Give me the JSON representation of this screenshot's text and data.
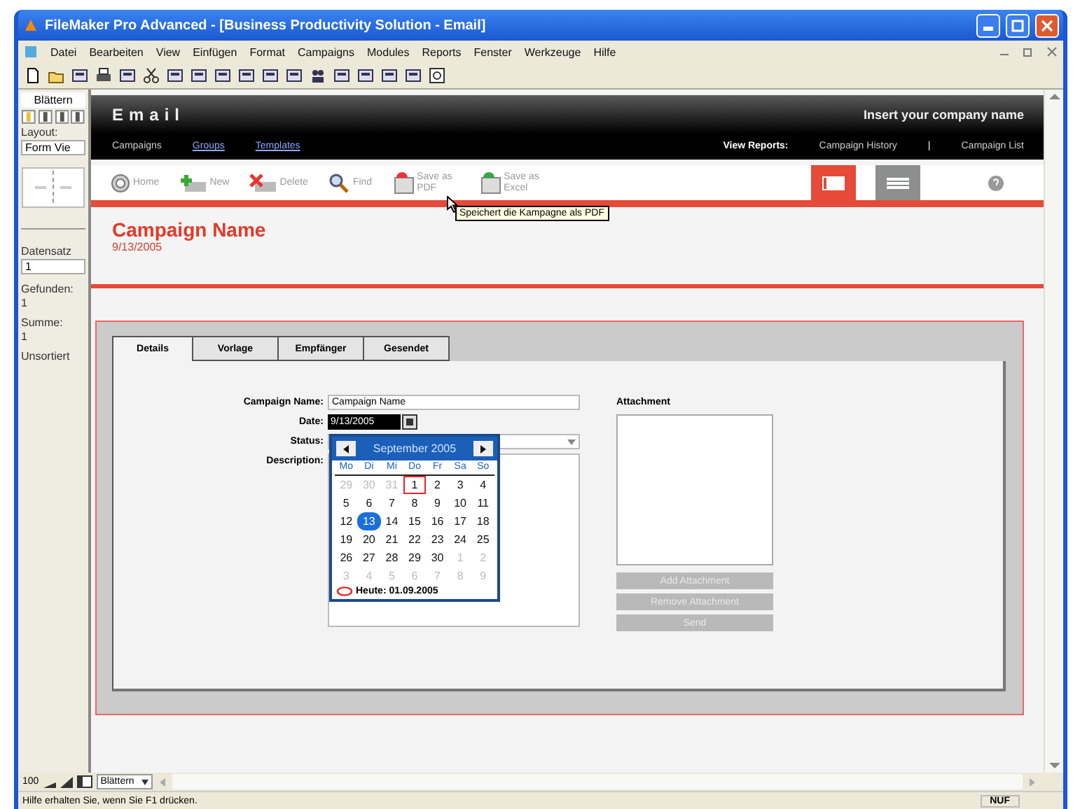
{
  "window": {
    "title": "FileMaker Pro Advanced - [Business Productivity Solution - Email]"
  },
  "menu": [
    "Datei",
    "Bearbeiten",
    "View",
    "Einfügen",
    "Format",
    "Campaigns",
    "Modules",
    "Reports",
    "Fenster",
    "Werkzeuge",
    "Hilfe"
  ],
  "sidebar": {
    "mode": "Blättern",
    "layout_label": "Layout:",
    "layout_value": "Form Vie",
    "record_label": "Datensatz",
    "record_value": "1",
    "found_label": "Gefunden:",
    "found_value": "1",
    "total_label": "Summe:",
    "total_value": "1",
    "sort_state": "Unsortiert"
  },
  "header": {
    "title": "Email",
    "company": "Insert your company name",
    "nav": [
      {
        "label": "Campaigns",
        "selected": true
      },
      {
        "label": "Groups",
        "selected": false
      },
      {
        "label": "Templates",
        "selected": false
      }
    ],
    "reports_label": "View Reports:",
    "reports": [
      "Campaign History",
      "Campaign List"
    ],
    "separator": "|"
  },
  "toolbar": [
    {
      "kind": "home",
      "label": "Home"
    },
    {
      "kind": "new",
      "label": "New"
    },
    {
      "kind": "delete",
      "label": "Delete"
    },
    {
      "kind": "find",
      "label": "Find"
    },
    {
      "kind": "pdf",
      "label": "Save as PDF"
    },
    {
      "kind": "excel",
      "label": "Save as Excel"
    }
  ],
  "views": [
    {
      "kind": "form",
      "selected": true
    },
    {
      "kind": "list",
      "selected": false
    }
  ],
  "tooltip": "Speichert die Kampagne als PDF",
  "record": {
    "name": "Campaign Name",
    "date": "9/13/2005"
  },
  "tabs": [
    {
      "label": "Details",
      "selected": true
    },
    {
      "label": "Vorlage",
      "selected": false
    },
    {
      "label": "Empfänger",
      "selected": false
    },
    {
      "label": "Gesendet",
      "selected": false
    }
  ],
  "form": {
    "name_label": "Campaign Name:",
    "name_value": "Campaign Name",
    "date_label": "Date:",
    "date_value": "9/13/2005",
    "status_label": "Status:",
    "description_label": "Description:",
    "attachment_label": "Attachment",
    "buttons": [
      {
        "label": "Add Attachment",
        "disabled": true
      },
      {
        "label": "Remove Attachment",
        "disabled": true
      },
      {
        "label": "Send",
        "disabled": true
      }
    ]
  },
  "calendar": {
    "month": "September 2005",
    "weekdays": [
      "Mo",
      "Di",
      "Mi",
      "Do",
      "Fr",
      "Sa",
      "So"
    ],
    "weeks": [
      [
        {
          "day": "29",
          "muted": true,
          "today": false,
          "selected": false
        },
        {
          "day": "30",
          "muted": true,
          "today": false,
          "selected": false
        },
        {
          "day": "31",
          "muted": true,
          "today": false,
          "selected": false
        },
        {
          "day": "1",
          "muted": false,
          "today": true,
          "selected": false
        },
        {
          "day": "2",
          "muted": false,
          "today": false,
          "selected": false
        },
        {
          "day": "3",
          "muted": false,
          "today": false,
          "selected": false
        },
        {
          "day": "4",
          "muted": false,
          "today": false,
          "selected": false
        }
      ],
      [
        {
          "day": "5",
          "muted": false,
          "today": false,
          "selected": false
        },
        {
          "day": "6",
          "muted": false,
          "today": false,
          "selected": false
        },
        {
          "day": "7",
          "muted": false,
          "today": false,
          "selected": false
        },
        {
          "day": "8",
          "muted": false,
          "today": false,
          "selected": false
        },
        {
          "day": "9",
          "muted": false,
          "today": false,
          "selected": false
        },
        {
          "day": "10",
          "muted": false,
          "today": false,
          "selected": false
        },
        {
          "day": "11",
          "muted": false,
          "today": false,
          "selected": false
        }
      ],
      [
        {
          "day": "12",
          "muted": false,
          "today": false,
          "selected": false
        },
        {
          "day": "13",
          "muted": false,
          "today": false,
          "selected": true
        },
        {
          "day": "14",
          "muted": false,
          "today": false,
          "selected": false
        },
        {
          "day": "15",
          "muted": false,
          "today": false,
          "selected": false
        },
        {
          "day": "16",
          "muted": false,
          "today": false,
          "selected": false
        },
        {
          "day": "17",
          "muted": false,
          "today": false,
          "selected": false
        },
        {
          "day": "18",
          "muted": false,
          "today": false,
          "selected": false
        }
      ],
      [
        {
          "day": "19",
          "muted": false,
          "today": false,
          "selected": false
        },
        {
          "day": "20",
          "muted": false,
          "today": false,
          "selected": false
        },
        {
          "day": "21",
          "muted": false,
          "today": false,
          "selected": false
        },
        {
          "day": "22",
          "muted": false,
          "today": false,
          "selected": false
        },
        {
          "day": "23",
          "muted": false,
          "today": false,
          "selected": false
        },
        {
          "day": "24",
          "muted": false,
          "today": false,
          "selected": false
        },
        {
          "day": "25",
          "muted": false,
          "today": false,
          "selected": false
        }
      ],
      [
        {
          "day": "26",
          "muted": false,
          "today": false,
          "selected": false
        },
        {
          "day": "27",
          "muted": false,
          "today": false,
          "selected": false
        },
        {
          "day": "28",
          "muted": false,
          "today": false,
          "selected": false
        },
        {
          "day": "29",
          "muted": false,
          "today": false,
          "selected": false
        },
        {
          "day": "30",
          "muted": false,
          "today": false,
          "selected": false
        },
        {
          "day": "1",
          "muted": true,
          "today": false,
          "selected": false
        },
        {
          "day": "2",
          "muted": true,
          "today": false,
          "selected": false
        }
      ],
      [
        {
          "day": "3",
          "muted": true,
          "today": false,
          "selected": false
        },
        {
          "day": "4",
          "muted": true,
          "today": false,
          "selected": false
        },
        {
          "day": "5",
          "muted": true,
          "today": false,
          "selected": false
        },
        {
          "day": "6",
          "muted": true,
          "today": false,
          "selected": false
        },
        {
          "day": "7",
          "muted": true,
          "today": false,
          "selected": false
        },
        {
          "day": "8",
          "muted": true,
          "today": false,
          "selected": false
        },
        {
          "day": "9",
          "muted": true,
          "today": false,
          "selected": false
        }
      ]
    ],
    "today_text": "Heute: 01.09.2005"
  },
  "bottom": {
    "zoom": "100",
    "mode": "Blättern"
  },
  "status_bar": {
    "text": "Hilfe erhalten Sie, wenn Sie F1 drücken.",
    "indicator": "NUF"
  }
}
